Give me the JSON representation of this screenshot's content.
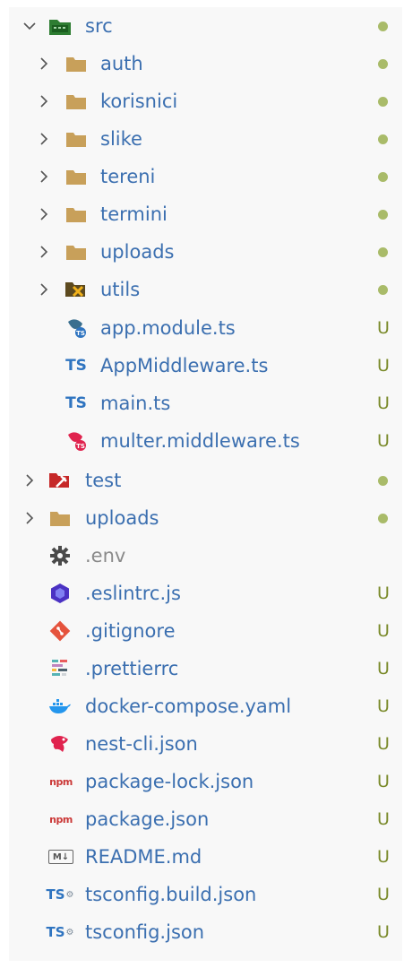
{
  "colors": {
    "folder": "#c8a05a",
    "ts": "#2f74c0",
    "nest": "#e0234e",
    "git": "#e5533d",
    "eslint": "#4b32c3",
    "docker": "#2496ed",
    "npm": "#cb3837",
    "status_dot": "#9bb050",
    "status_u": "#7a8a2a"
  },
  "tree": {
    "src": {
      "label": "src",
      "status": "dot",
      "icon": "src-folder-icon"
    },
    "auth": {
      "label": "auth",
      "status": "dot",
      "icon": "folder-icon"
    },
    "korisnici": {
      "label": "korisnici",
      "status": "dot",
      "icon": "folder-icon"
    },
    "slike": {
      "label": "slike",
      "status": "dot",
      "icon": "folder-icon"
    },
    "tereni": {
      "label": "tereni",
      "status": "dot",
      "icon": "folder-icon"
    },
    "termini": {
      "label": "termini",
      "status": "dot",
      "icon": "folder-icon"
    },
    "uploads_src": {
      "label": "uploads",
      "status": "dot",
      "icon": "folder-icon"
    },
    "utils": {
      "label": "utils",
      "status": "dot",
      "icon": "utils-folder-icon"
    },
    "app_module": {
      "label": "app.module.ts",
      "status": "U",
      "icon": "nest-module-icon"
    },
    "app_middleware": {
      "label": "AppMiddleware.ts",
      "status": "U",
      "icon": "typescript-icon",
      "icon_text": "TS"
    },
    "main_ts": {
      "label": "main.ts",
      "status": "U",
      "icon": "typescript-icon",
      "icon_text": "TS"
    },
    "multer": {
      "label": "multer.middleware.ts",
      "status": "U",
      "icon": "nest-middleware-icon"
    },
    "test": {
      "label": "test",
      "status": "dot",
      "icon": "test-folder-icon"
    },
    "uploads": {
      "label": "uploads",
      "status": "dot",
      "icon": "folder-icon"
    },
    "env": {
      "label": ".env",
      "status": "",
      "icon": "gear-icon"
    },
    "eslintrc": {
      "label": ".eslintrc.js",
      "status": "U",
      "icon": "eslint-icon"
    },
    "gitignore": {
      "label": ".gitignore",
      "status": "U",
      "icon": "git-icon"
    },
    "prettierrc": {
      "label": ".prettierrc",
      "status": "U",
      "icon": "prettier-icon"
    },
    "docker": {
      "label": "docker-compose.yaml",
      "status": "U",
      "icon": "docker-icon"
    },
    "nestcli": {
      "label": "nest-cli.json",
      "status": "U",
      "icon": "nest-icon"
    },
    "pkglock": {
      "label": "package-lock.json",
      "status": "U",
      "icon": "npm-icon",
      "icon_text": "npm"
    },
    "pkg": {
      "label": "package.json",
      "status": "U",
      "icon": "npm-icon",
      "icon_text": "npm"
    },
    "readme": {
      "label": "README.md",
      "status": "U",
      "icon": "markdown-icon",
      "icon_text": "M↓"
    },
    "tsbuild": {
      "label": "tsconfig.build.json",
      "status": "U",
      "icon": "tsconfig-icon",
      "icon_text": "TS"
    },
    "tsconfig": {
      "label": "tsconfig.json",
      "status": "U",
      "icon": "tsconfig-icon",
      "icon_text": "TS"
    }
  }
}
